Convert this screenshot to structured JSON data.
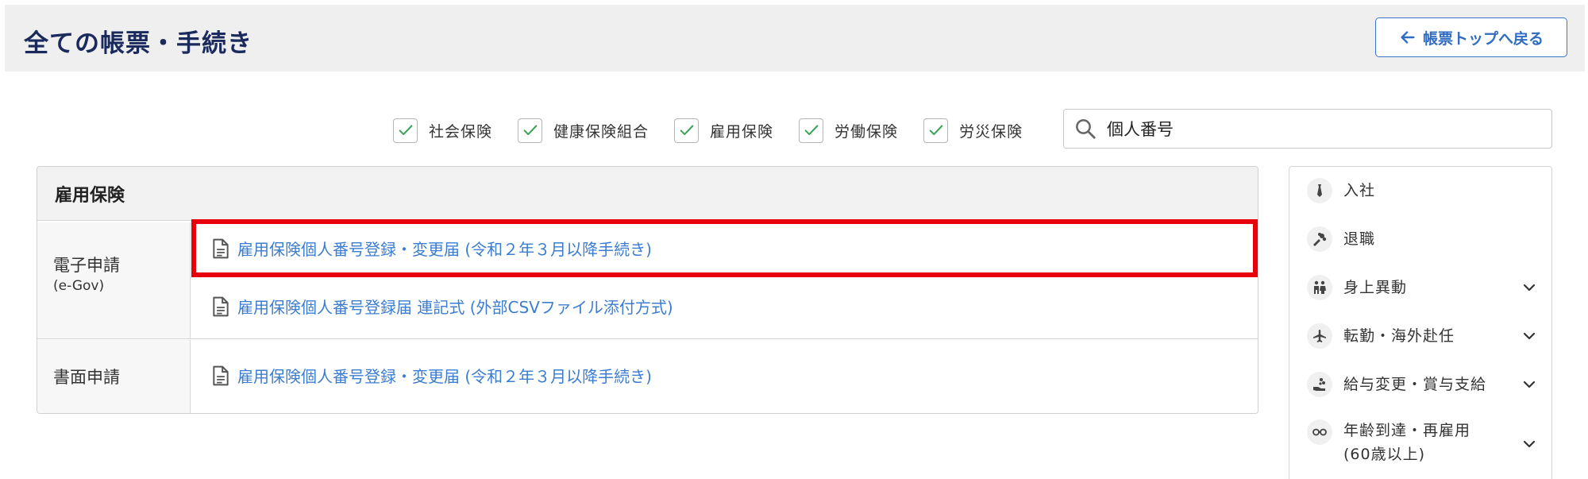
{
  "header": {
    "title": "全ての帳票・手続き",
    "back_label": "帳票トップへ戻る"
  },
  "filters": [
    {
      "label": "社会保険",
      "checked": true
    },
    {
      "label": "健康保険組合",
      "checked": true
    },
    {
      "label": "雇用保険",
      "checked": true
    },
    {
      "label": "労働保険",
      "checked": true
    },
    {
      "label": "労災保険",
      "checked": true
    }
  ],
  "search": {
    "value": "個人番号"
  },
  "panel": {
    "title": "雇用保険",
    "rows": [
      {
        "label": "電子申請",
        "sublabel": "(e-Gov)",
        "links": [
          "雇用保険個人番号登録・変更届 (令和２年３月以降手続き)",
          "雇用保険個人番号登録届 連記式 (外部CSVファイル添付方式)"
        ]
      },
      {
        "label": "書面申請",
        "links": [
          "雇用保険個人番号登録・変更届 (令和２年３月以降手続き)"
        ]
      }
    ]
  },
  "sidebar": {
    "items": [
      {
        "label": "入社",
        "icon": "necktie-icon",
        "expandable": false
      },
      {
        "label": "退職",
        "icon": "bouquet-icon",
        "expandable": false
      },
      {
        "label": "身上異動",
        "icon": "family-icon",
        "expandable": true
      },
      {
        "label": "転勤・海外赴任",
        "icon": "airplane-icon",
        "expandable": true
      },
      {
        "label": "給与変更・賞与支給",
        "icon": "money-hand-icon",
        "expandable": true
      },
      {
        "label": "年齢到達・再雇用",
        "label2": "(60歳以上)",
        "icon": "glasses-icon",
        "expandable": true
      }
    ]
  },
  "colors": {
    "accent": "#3b7dd0",
    "title": "#1b2a5c",
    "highlight": "#e8000b",
    "check": "#3aa356"
  }
}
